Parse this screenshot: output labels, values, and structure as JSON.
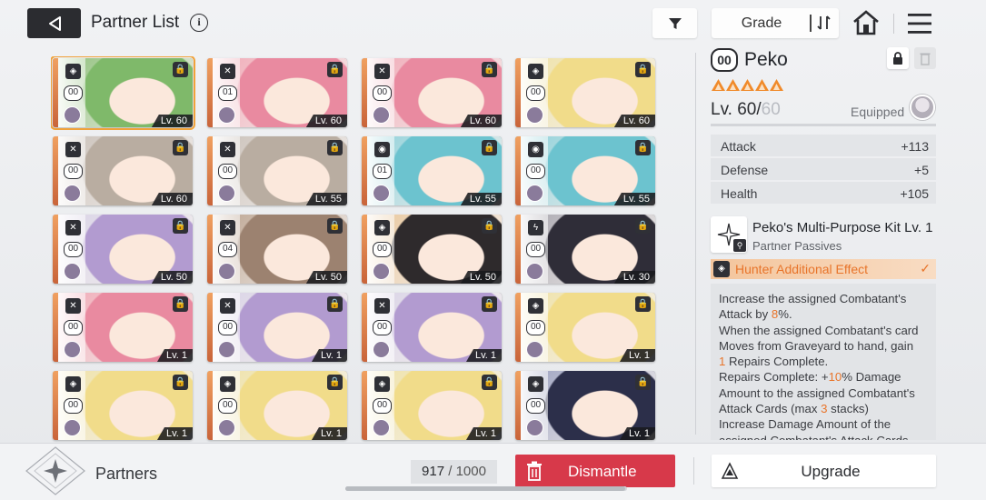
{
  "header": {
    "title": "Partner List",
    "sort_label": "Grade"
  },
  "cards": [
    {
      "badge": "00",
      "level": "Lv. 60",
      "type": "◈",
      "selected": true,
      "color": "#8ec07a",
      "hair": "#7fb96a"
    },
    {
      "badge": "01",
      "level": "Lv. 60",
      "type": "✕",
      "color": "#f0a9b6",
      "hair": "#e98aa0"
    },
    {
      "badge": "00",
      "level": "Lv. 60",
      "type": "✕",
      "color": "#f0a9b6",
      "hair": "#e98aa0"
    },
    {
      "badge": "00",
      "level": "Lv. 60",
      "type": "◈",
      "color": "#efe2a6",
      "hair": "#f1dc8a"
    },
    {
      "badge": "00",
      "level": "Lv. 60",
      "type": "✕",
      "color": "#c9c0b8",
      "hair": "#b9ada1"
    },
    {
      "badge": "00",
      "level": "Lv. 55",
      "type": "✕",
      "color": "#c9c0b8",
      "hair": "#b9ada1"
    },
    {
      "badge": "01",
      "level": "Lv. 55",
      "type": "◉",
      "color": "#8fd1da",
      "hair": "#6cc3cf"
    },
    {
      "badge": "00",
      "level": "Lv. 55",
      "type": "◉",
      "color": "#8fd1da",
      "hair": "#6cc3cf"
    },
    {
      "badge": "00",
      "level": "Lv. 50",
      "type": "✕",
      "color": "#d9d3e6",
      "hair": "#b29bd0"
    },
    {
      "badge": "04",
      "level": "Lv. 50",
      "type": "✕",
      "color": "#bba38f",
      "hair": "#9c8270"
    },
    {
      "badge": "00",
      "level": "Lv. 50",
      "type": "◈",
      "color": "#e9c79c",
      "hair": "#2e2a2c"
    },
    {
      "badge": "00",
      "level": "Lv. 30",
      "type": "ϟ",
      "color": "#a8a6ae",
      "hair": "#2f2d38"
    },
    {
      "badge": "00",
      "level": "Lv. 1",
      "type": "✕",
      "color": "#f0a9b6",
      "hair": "#e98aa0"
    },
    {
      "badge": "00",
      "level": "Lv. 1",
      "type": "✕",
      "color": "#d9d3e6",
      "hair": "#b29bd0"
    },
    {
      "badge": "00",
      "level": "Lv. 1",
      "type": "✕",
      "color": "#d9d3e6",
      "hair": "#b29bd0"
    },
    {
      "badge": "00",
      "level": "Lv. 1",
      "type": "◈",
      "color": "#efe2a6",
      "hair": "#f1dc8a"
    },
    {
      "badge": "00",
      "level": "Lv. 1",
      "type": "◈",
      "color": "#efe2a6",
      "hair": "#f1dc8a"
    },
    {
      "badge": "00",
      "level": "Lv. 1",
      "type": "◈",
      "color": "#efe2a6",
      "hair": "#f1dc8a"
    },
    {
      "badge": "00",
      "level": "Lv. 1",
      "type": "◈",
      "color": "#efe2a6",
      "hair": "#f1dc8a"
    },
    {
      "badge": "00",
      "level": "Lv. 1",
      "type": "◈",
      "color": "#9aa0bf",
      "hair": "#2c2f4a"
    }
  ],
  "detail": {
    "badge": "00",
    "name": "Peko",
    "stars": 5,
    "level": "Lv. 60/",
    "level_max": "60",
    "equipped_label": "Equipped",
    "stats": [
      {
        "name": "Attack",
        "value": "+113"
      },
      {
        "name": "Defense",
        "value": "+5"
      },
      {
        "name": "Health",
        "value": "+105"
      }
    ],
    "skill_title": "Peko's Multi-Purpose Kit Lv. 1",
    "skill_sub": "Partner Passives",
    "effect_label": "Hunter Additional Effect",
    "desc": {
      "l1": "Increase the assigned Combatant's Attack by ",
      "v1": "8",
      "l2": "%.",
      "l3": "When the assigned Combatant's card Moves from Graveyard to hand, gain ",
      "v2": "1",
      "l4": " Repairs Complete.",
      "l5": "Repairs Complete: +",
      "v3": "10",
      "l6": "% Damage Amount to the assigned Combatant's Attack Cards (max ",
      "v4": "3",
      "l7": " stacks)",
      "l8": "Increase Damage Amount of the assigned Combatant's Attack Cards"
    }
  },
  "footer": {
    "label": "Partners",
    "capacity_current": "917",
    "capacity_sep": " / ",
    "capacity_max": "1000",
    "dismantle_label": "Dismantle",
    "upgrade_label": "Upgrade"
  },
  "colors": {
    "accent": "#e8742a",
    "dismantle": "#d7394a",
    "selected_outline": "#f0a23a"
  }
}
